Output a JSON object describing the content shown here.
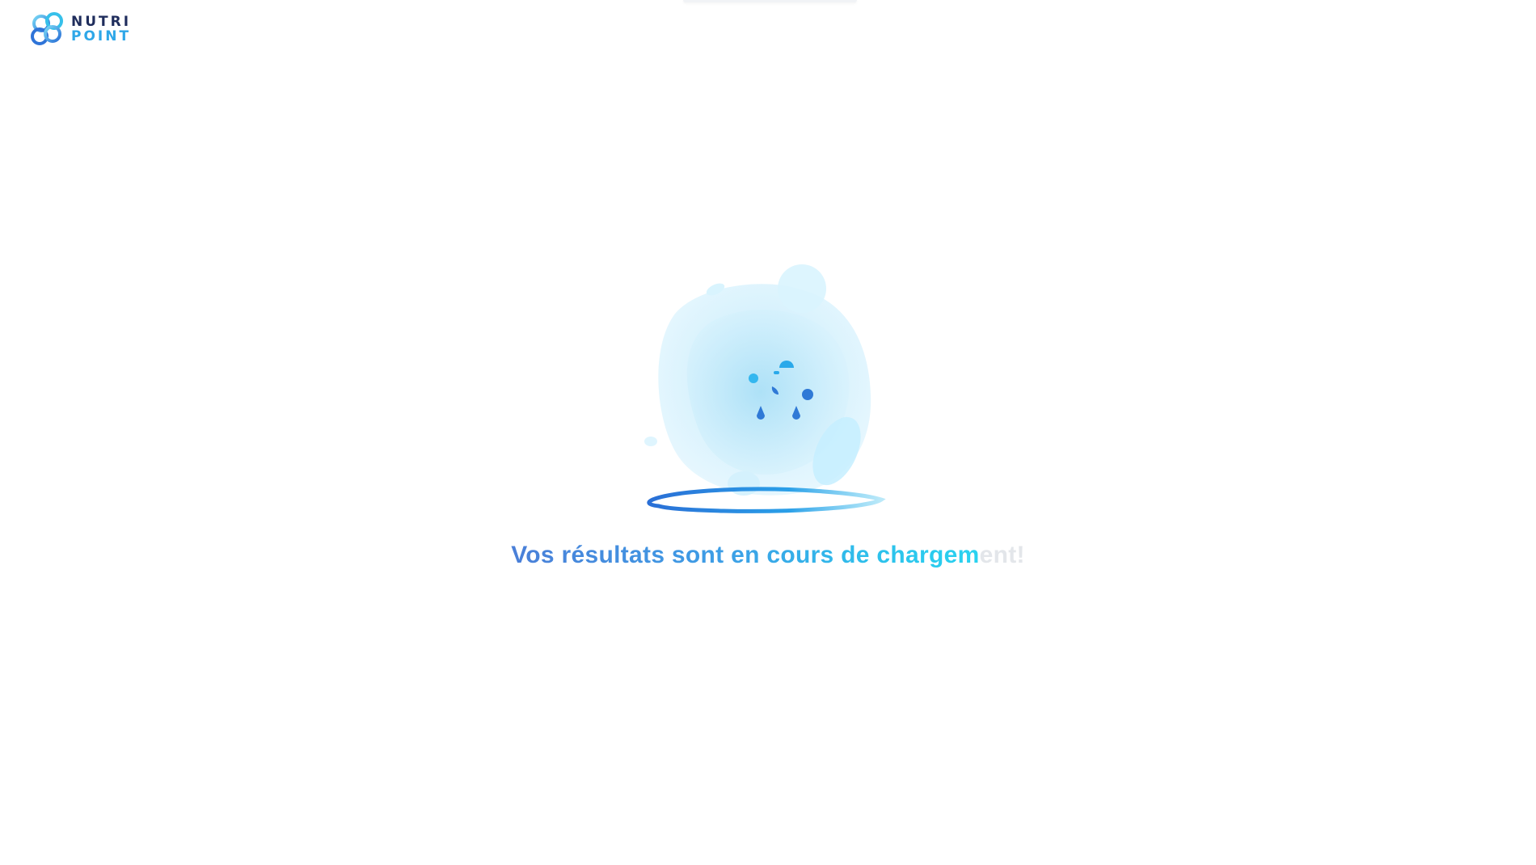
{
  "brand": {
    "logo_icon": "nutripoint-logo-icon",
    "line1": "NUTRI",
    "line2": "POINT",
    "colors": {
      "dark": "#1f2d5c",
      "accent": "#2ea7e8"
    }
  },
  "loader": {
    "illustration_icon": "loading-blob-icon",
    "message_highlighted": "Vos résultats sont en cours de chargem",
    "message_faded": "ent!",
    "gradient_colors": [
      "#4a7fd8",
      "#3d9ee6",
      "#2cc3ec",
      "#29d3f0"
    ],
    "faded_color": "#e3e6ea"
  }
}
